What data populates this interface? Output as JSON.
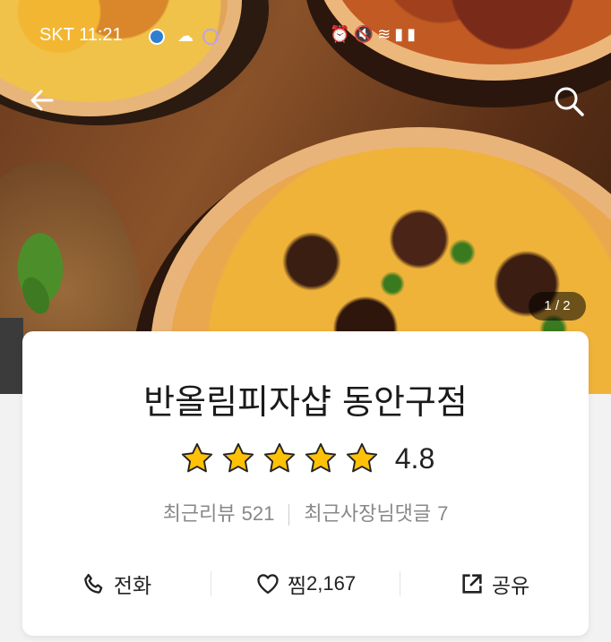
{
  "status_bar": {
    "carrier_time": "SKT 11:21",
    "icons": [
      "weather-icon",
      "sun-cloud-icon",
      "face-icon",
      "alarm-icon",
      "mute-icon",
      "wifi-icon",
      "signal-icon",
      "battery-icon"
    ]
  },
  "gallery": {
    "pager": "1 / 2"
  },
  "store": {
    "name": "반올림피자샵 동안구점",
    "rating": "4.8",
    "stars": 5,
    "reviews_label": "최근리뷰",
    "reviews_count": "521",
    "owner_replies_label": "최근사장님댓글",
    "owner_replies_count": "7"
  },
  "actions": {
    "call_label": "전화",
    "favorite_label": "찜",
    "favorite_count": "2,167",
    "share_label": "공유"
  },
  "colors": {
    "star": "#FFC107",
    "text_primary": "#1a1a1a",
    "text_secondary": "#888888"
  }
}
